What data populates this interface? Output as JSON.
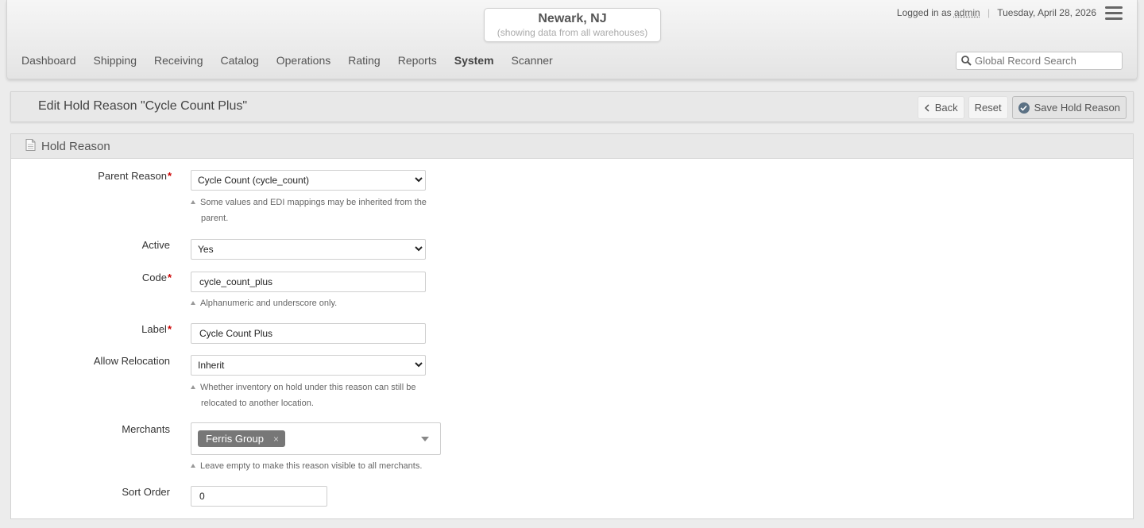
{
  "header": {
    "warehouse_name": "Newark, NJ",
    "warehouse_sub": "(showing data from all warehouses)",
    "logged_in_prefix": "Logged in as",
    "user": "admin",
    "separator": "|",
    "date": "Tuesday, April 28, 2026",
    "nav": [
      {
        "label": "Dashboard"
      },
      {
        "label": "Shipping"
      },
      {
        "label": "Receiving"
      },
      {
        "label": "Catalog"
      },
      {
        "label": "Operations"
      },
      {
        "label": "Rating"
      },
      {
        "label": "Reports"
      },
      {
        "label": "System",
        "active": true
      },
      {
        "label": "Scanner"
      }
    ],
    "search_placeholder": "Global Record Search"
  },
  "titlebar": {
    "title": "Edit Hold Reason \"Cycle Count Plus\"",
    "back_label": "Back",
    "reset_label": "Reset",
    "save_label": "Save Hold Reason"
  },
  "form": {
    "section_title": "Hold Reason",
    "parent_reason": {
      "label": "Parent Reason",
      "required": "*",
      "value": "Cycle Count (cycle_count)",
      "hint_line1": "Some values and EDI mappings may be inherited from the",
      "hint_line2": "parent."
    },
    "active": {
      "label": "Active",
      "value": "Yes"
    },
    "code": {
      "label": "Code",
      "required": "*",
      "value": "cycle_count_plus",
      "hint": "Alphanumeric and underscore only."
    },
    "label_field": {
      "label": "Label",
      "required": "*",
      "value": "Cycle Count Plus"
    },
    "allow_relocation": {
      "label": "Allow Relocation",
      "value": "Inherit",
      "hint_line1": "Whether inventory on hold under this reason can still be",
      "hint_line2": "relocated to another location."
    },
    "merchants": {
      "label": "Merchants",
      "tags": [
        "Ferris Group"
      ],
      "remove_glyph": "×",
      "hint": "Leave empty to make this reason visible to all merchants."
    },
    "sort_order": {
      "label": "Sort Order",
      "value": "0"
    }
  }
}
